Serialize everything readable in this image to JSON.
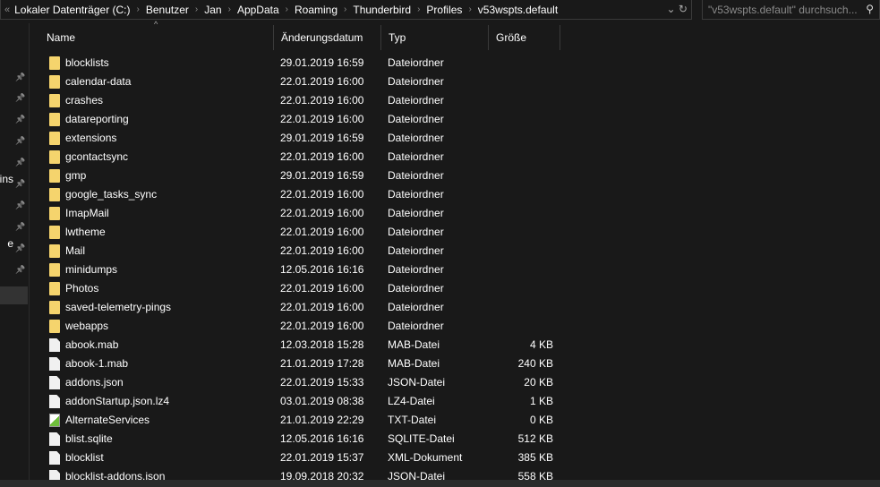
{
  "breadcrumb": [
    "Lokaler Datenträger (C:)",
    "Benutzer",
    "Jan",
    "AppData",
    "Roaming",
    "Thunderbird",
    "Profiles",
    "v53wspts.default"
  ],
  "search": {
    "placeholder": "\"v53wspts.default\" durchsuch..."
  },
  "sidebar": {
    "partial_labels": [
      "ains",
      "e"
    ]
  },
  "columns": {
    "name": "Name",
    "date": "Änderungsdatum",
    "type": "Typ",
    "size": "Größe"
  },
  "files": [
    {
      "name": "blocklists",
      "date": "29.01.2019 16:59",
      "type": "Dateiordner",
      "size": "",
      "icon": "folder"
    },
    {
      "name": "calendar-data",
      "date": "22.01.2019 16:00",
      "type": "Dateiordner",
      "size": "",
      "icon": "folder"
    },
    {
      "name": "crashes",
      "date": "22.01.2019 16:00",
      "type": "Dateiordner",
      "size": "",
      "icon": "folder"
    },
    {
      "name": "datareporting",
      "date": "22.01.2019 16:00",
      "type": "Dateiordner",
      "size": "",
      "icon": "folder"
    },
    {
      "name": "extensions",
      "date": "29.01.2019 16:59",
      "type": "Dateiordner",
      "size": "",
      "icon": "folder"
    },
    {
      "name": "gcontactsync",
      "date": "22.01.2019 16:00",
      "type": "Dateiordner",
      "size": "",
      "icon": "folder"
    },
    {
      "name": "gmp",
      "date": "29.01.2019 16:59",
      "type": "Dateiordner",
      "size": "",
      "icon": "folder"
    },
    {
      "name": "google_tasks_sync",
      "date": "22.01.2019 16:00",
      "type": "Dateiordner",
      "size": "",
      "icon": "folder"
    },
    {
      "name": "ImapMail",
      "date": "22.01.2019 16:00",
      "type": "Dateiordner",
      "size": "",
      "icon": "folder"
    },
    {
      "name": "lwtheme",
      "date": "22.01.2019 16:00",
      "type": "Dateiordner",
      "size": "",
      "icon": "folder"
    },
    {
      "name": "Mail",
      "date": "22.01.2019 16:00",
      "type": "Dateiordner",
      "size": "",
      "icon": "folder"
    },
    {
      "name": "minidumps",
      "date": "12.05.2016 16:16",
      "type": "Dateiordner",
      "size": "",
      "icon": "folder"
    },
    {
      "name": "Photos",
      "date": "22.01.2019 16:00",
      "type": "Dateiordner",
      "size": "",
      "icon": "folder"
    },
    {
      "name": "saved-telemetry-pings",
      "date": "22.01.2019 16:00",
      "type": "Dateiordner",
      "size": "",
      "icon": "folder"
    },
    {
      "name": "webapps",
      "date": "22.01.2019 16:00",
      "type": "Dateiordner",
      "size": "",
      "icon": "folder"
    },
    {
      "name": "abook.mab",
      "date": "12.03.2018 15:28",
      "type": "MAB-Datei",
      "size": "4 KB",
      "icon": "file"
    },
    {
      "name": "abook-1.mab",
      "date": "21.01.2019 17:28",
      "type": "MAB-Datei",
      "size": "240 KB",
      "icon": "file"
    },
    {
      "name": "addons.json",
      "date": "22.01.2019 15:33",
      "type": "JSON-Datei",
      "size": "20 KB",
      "icon": "file"
    },
    {
      "name": "addonStartup.json.lz4",
      "date": "03.01.2019 08:38",
      "type": "LZ4-Datei",
      "size": "1 KB",
      "icon": "file"
    },
    {
      "name": "AlternateServices",
      "date": "21.01.2019 22:29",
      "type": "TXT-Datei",
      "size": "0 KB",
      "icon": "txt"
    },
    {
      "name": "blist.sqlite",
      "date": "12.05.2016 16:16",
      "type": "SQLITE-Datei",
      "size": "512 KB",
      "icon": "file"
    },
    {
      "name": "blocklist",
      "date": "22.01.2019 15:37",
      "type": "XML-Dokument",
      "size": "385 KB",
      "icon": "file"
    },
    {
      "name": "blocklist-addons.json",
      "date": "19.09.2018 20:32",
      "type": "JSON-Datei",
      "size": "558 KB",
      "icon": "file"
    }
  ]
}
